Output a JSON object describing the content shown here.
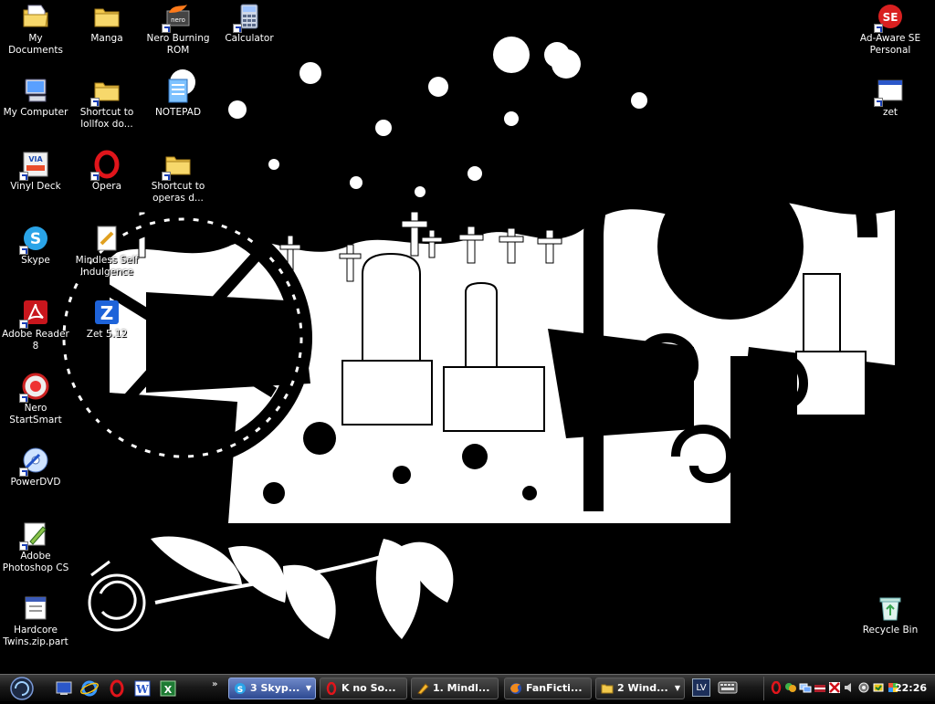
{
  "desktop": {
    "icons": [
      {
        "label": "My Documents",
        "icon": "my-documents-icon"
      },
      {
        "label": "Manga",
        "icon": "folder-icon"
      },
      {
        "label": "Nero Burning\nROM",
        "icon": "nero-icon"
      },
      {
        "label": "Calculator",
        "icon": "calculator-icon"
      },
      {
        "label": "Ad-Aware SE\nPersonal",
        "icon": "ad-aware-icon"
      },
      {
        "label": "My Computer",
        "icon": "my-computer-icon"
      },
      {
        "label": "Shortcut to\nlollfox do...",
        "icon": "folder-icon"
      },
      {
        "label": "NOTEPAD",
        "icon": "notepad-icon"
      },
      {
        "label": "zet",
        "icon": "window-icon"
      },
      {
        "label": "Vinyl Deck",
        "icon": "vinyl-deck-icon"
      },
      {
        "label": "Opera",
        "icon": "opera-icon"
      },
      {
        "label": "Shortcut to\noperas d...",
        "icon": "folder-icon"
      },
      {
        "label": "Skype",
        "icon": "skype-icon"
      },
      {
        "label": "Mindless Self\nIndulgence",
        "icon": "document-icon"
      },
      {
        "label": "Adobe Reader\n8",
        "icon": "adobe-reader-icon"
      },
      {
        "label": "Zet 5.12",
        "icon": "zet-icon"
      },
      {
        "label": "Nero\nStartSmart",
        "icon": "nero-startsmart-icon"
      },
      {
        "label": "PowerDVD",
        "icon": "powerdvd-icon"
      },
      {
        "label": "Adobe\nPhotoshop CS",
        "icon": "photoshop-icon"
      },
      {
        "label": "Hardcore\nTwins.zip.part",
        "icon": "file-icon"
      },
      {
        "label": "Recycle Bin",
        "icon": "recycle-bin-icon"
      }
    ]
  },
  "taskbar": {
    "quick_launch": [
      {
        "name": "show-desktop-icon"
      },
      {
        "name": "internet-explorer-icon"
      },
      {
        "name": "opera-icon"
      },
      {
        "name": "word-icon"
      },
      {
        "name": "excel-icon"
      }
    ],
    "chevron": "»",
    "buttons": [
      {
        "label": "3 Skyp...",
        "icon": "skype-icon",
        "active": true,
        "dropdown": "▼"
      },
      {
        "label": "K no So...",
        "icon": "opera-icon",
        "active": false
      },
      {
        "label": "1. Mindl...",
        "icon": "pencil-icon",
        "active": false
      },
      {
        "label": "FanFicti...",
        "icon": "firefox-icon",
        "active": false
      },
      {
        "label": "2 Wind...",
        "icon": "folder-icon",
        "active": false,
        "dropdown": "▼"
      }
    ],
    "language": "LV",
    "clock": "22:26"
  },
  "colors": {
    "accent": "#2e4a92",
    "taskbar_dark": "#050505"
  }
}
